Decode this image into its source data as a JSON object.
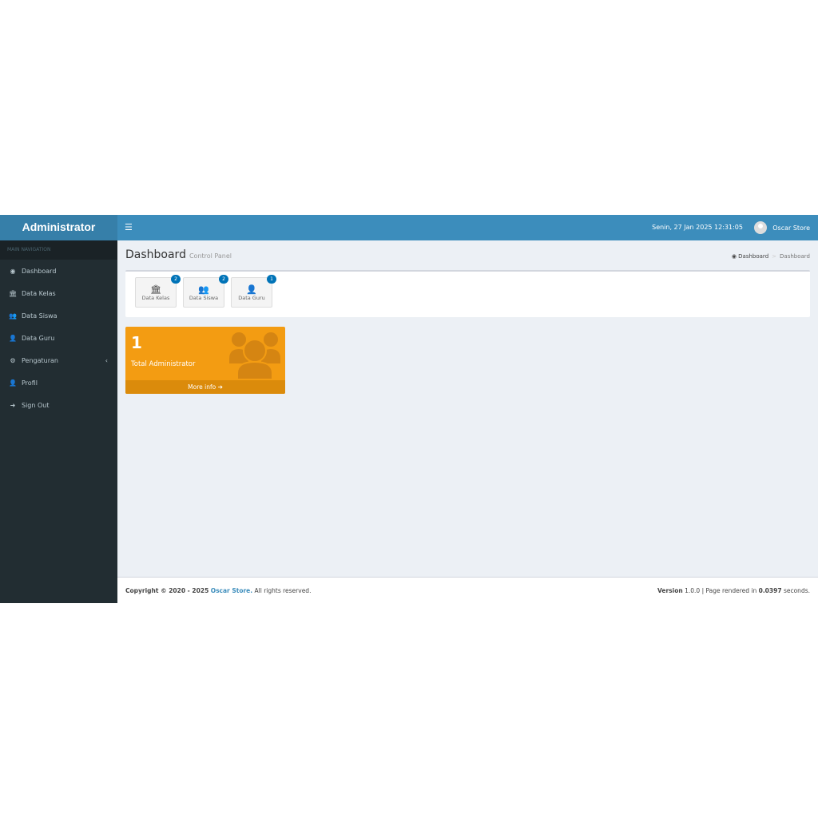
{
  "header": {
    "logo": "Administrator",
    "toggle_icon": "☰",
    "datetime": "Senin, 27 Jan 2025 12:31:05",
    "user": "Oscar Store"
  },
  "sidebar": {
    "nav_header": "MAIN NAVIGATION",
    "items": [
      {
        "label": "Dashboard",
        "icon": "◉"
      },
      {
        "label": "Data Kelas",
        "icon": "🏛"
      },
      {
        "label": "Data Siswa",
        "icon": "👥"
      },
      {
        "label": "Data Guru",
        "icon": "👤"
      },
      {
        "label": "Pengaturan",
        "icon": "⚙"
      },
      {
        "label": "Profil",
        "icon": "👤"
      },
      {
        "label": "Sign Out",
        "icon": "➜"
      }
    ],
    "chevron": "‹"
  },
  "page": {
    "title": "Dashboard",
    "subtitle": "Control Panel",
    "breadcrumb": [
      "Dashboard",
      "Dashboard"
    ],
    "breadcrumb_sep": ">"
  },
  "apps": [
    {
      "label": "Data Kelas",
      "badge": "2",
      "icon": "🏛"
    },
    {
      "label": "Data Siswa",
      "badge": "2",
      "icon": "👥"
    },
    {
      "label": "Data Guru",
      "badge": "1",
      "icon": "👤"
    }
  ],
  "stat": {
    "value": "1",
    "label": "Total Administrator",
    "more": "More info ➔",
    "color": "#f39c12"
  },
  "footer": {
    "copy_prefix": "Copyright © 2020 - 2025",
    "brand": "Oscar Store.",
    "copy_suffix": "All rights reserved.",
    "version_label": "Version",
    "version": "1.0.0",
    "render_prefix": "| Page rendered in",
    "render_time": "0.0397",
    "render_suffix": "seconds."
  }
}
